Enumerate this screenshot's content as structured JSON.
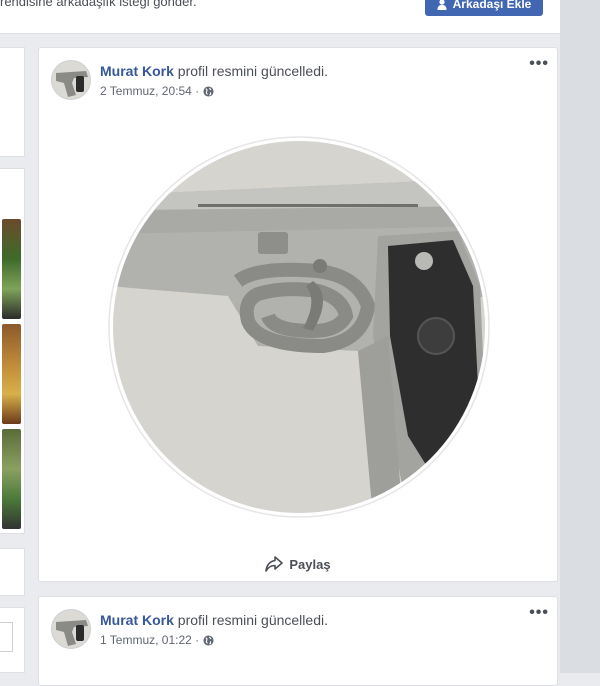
{
  "top_bar": {
    "request_text": "rendisine arkadaşlık isteği gönder.",
    "add_friend_label": "Arkadaşı Ekle"
  },
  "posts": [
    {
      "author": "Murat Kork",
      "action": "profil resmini güncelledi.",
      "date": "2 Temmuz, 20:54 ·",
      "share_label": "Paylaş"
    },
    {
      "author": "Murat Kork",
      "action": "profil resmini güncelledi.",
      "date": "1 Temmuz, 01:22 ·"
    }
  ],
  "icons": {
    "more": "more-options-icon",
    "privacy": "globe-icon",
    "share": "share-arrow-icon",
    "add_friend": "person-add-icon"
  },
  "colors": {
    "link": "#365899",
    "button": "#4267b2",
    "background": "#e9ebee"
  }
}
